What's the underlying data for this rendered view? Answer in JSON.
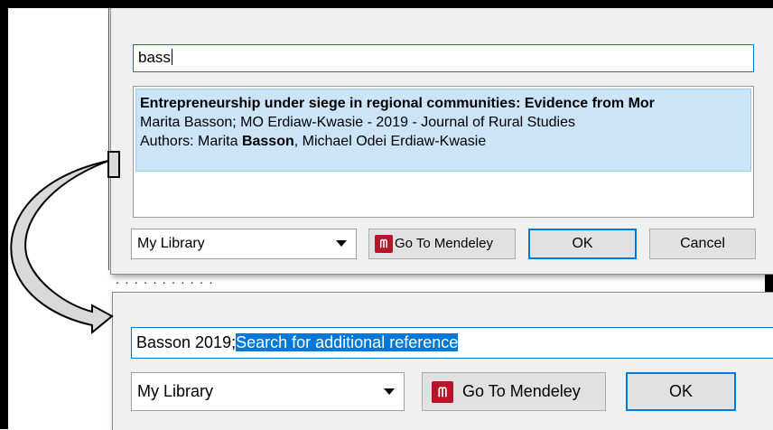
{
  "top_dialog": {
    "search_value": "bass",
    "results": [
      {
        "title": "Entrepreneurship under siege in regional communities: Evidence from Mor",
        "byline": "Marita Basson; MO Erdiaw-Kwasie - 2019 - Journal of Rural Studies",
        "authors_prefix": "Authors: Marita ",
        "authors_match": "Basson",
        "authors_suffix": ", Michael Odei Erdiaw-Kwasie"
      }
    ],
    "library_select": "My Library",
    "mendeley_button": "Go To Mendeley",
    "ok_button": "OK",
    "cancel_button": "Cancel"
  },
  "bottom_dialog": {
    "search_committed": "Basson 2019;",
    "search_placeholder_selected": "Search for additional reference",
    "library_select": "My Library",
    "mendeley_button": "Go To Mendeley",
    "ok_button": "OK"
  },
  "icons": {
    "mendeley_logo": "mendeley-logo-icon",
    "dropdown": "chevron-down-icon",
    "flow_arrow": "curved-arrow-icon"
  },
  "colors": {
    "selection_blue": "#0078d7",
    "result_highlight": "#cce4f7",
    "mendeley_red": "#b8142a"
  }
}
